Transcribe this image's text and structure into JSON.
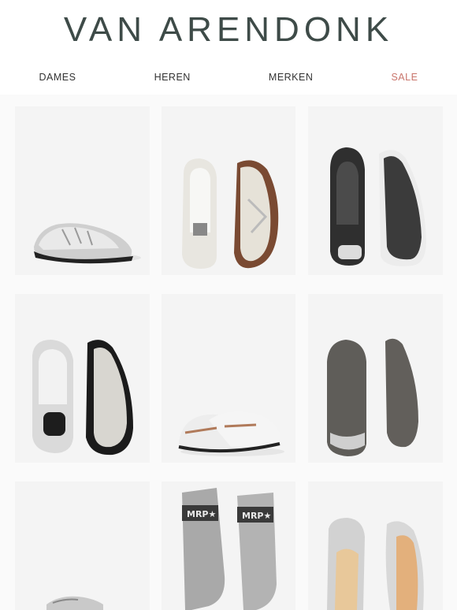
{
  "brand": {
    "logo_text": "VAN ARENDONK"
  },
  "nav": {
    "items": [
      {
        "label": "DAMES"
      },
      {
        "label": "HEREN"
      },
      {
        "label": "MERKEN"
      },
      {
        "label": "SALE"
      }
    ]
  },
  "products": {
    "sock_text": "MRP★"
  },
  "colors": {
    "logo": "#3e4b48",
    "sale": "#c9756c"
  }
}
